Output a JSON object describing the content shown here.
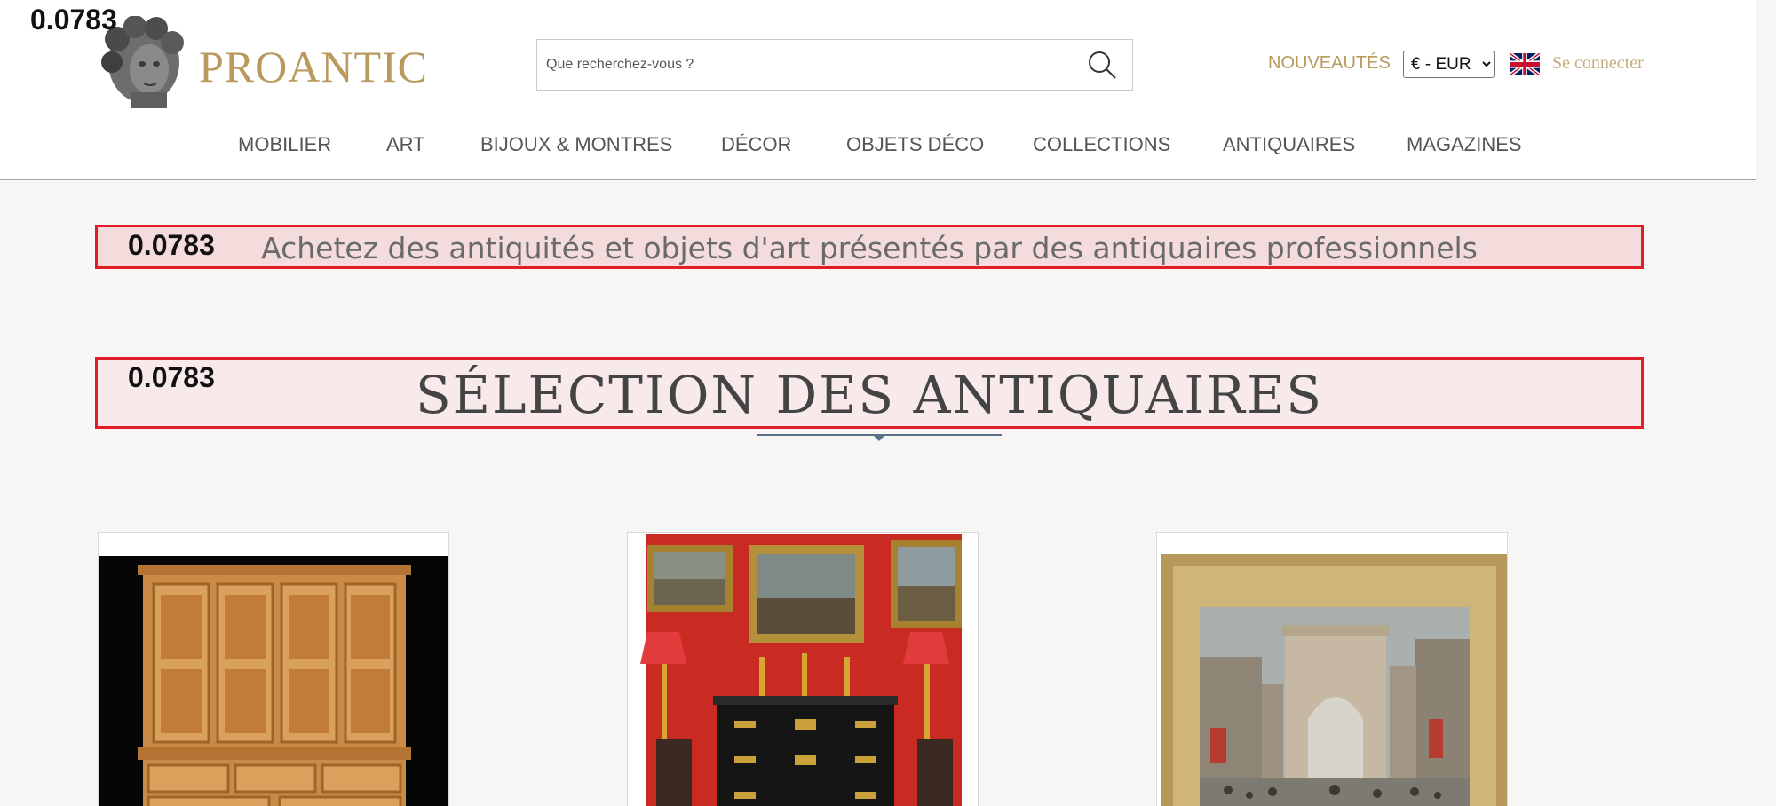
{
  "score_label": "0.0783",
  "brand": {
    "name": "PROANTIC"
  },
  "search": {
    "placeholder": "Que recherchez-vous ?"
  },
  "header_links": {
    "nouveautes": "NOUVEAUTÉS",
    "currency_selected": "€ - EUR",
    "login": "Se connecter"
  },
  "nav": {
    "items": [
      "MOBILIER",
      "ART",
      "BIJOUX & MONTRES",
      "DÉCOR",
      "OBJETS DÉCO",
      "COLLECTIONS",
      "ANTIQUAIRES",
      "MAGAZINES"
    ]
  },
  "tagline": "Achetez des antiquités et objets d'art présentés par des antiquaires professionnels",
  "section_title": "SÉLECTION DES ANTIQUAIRES",
  "colors": {
    "brand_gold": "#b9995c",
    "highlight_border": "#e11d2a",
    "underline": "#5a7189"
  },
  "products": [
    {
      "image": "pine-cabinet"
    },
    {
      "image": "red-room-commode"
    },
    {
      "image": "framed-paris-painting"
    }
  ],
  "icons": [
    "search-icon",
    "uk-flag-icon",
    "logo-bust-icon"
  ]
}
